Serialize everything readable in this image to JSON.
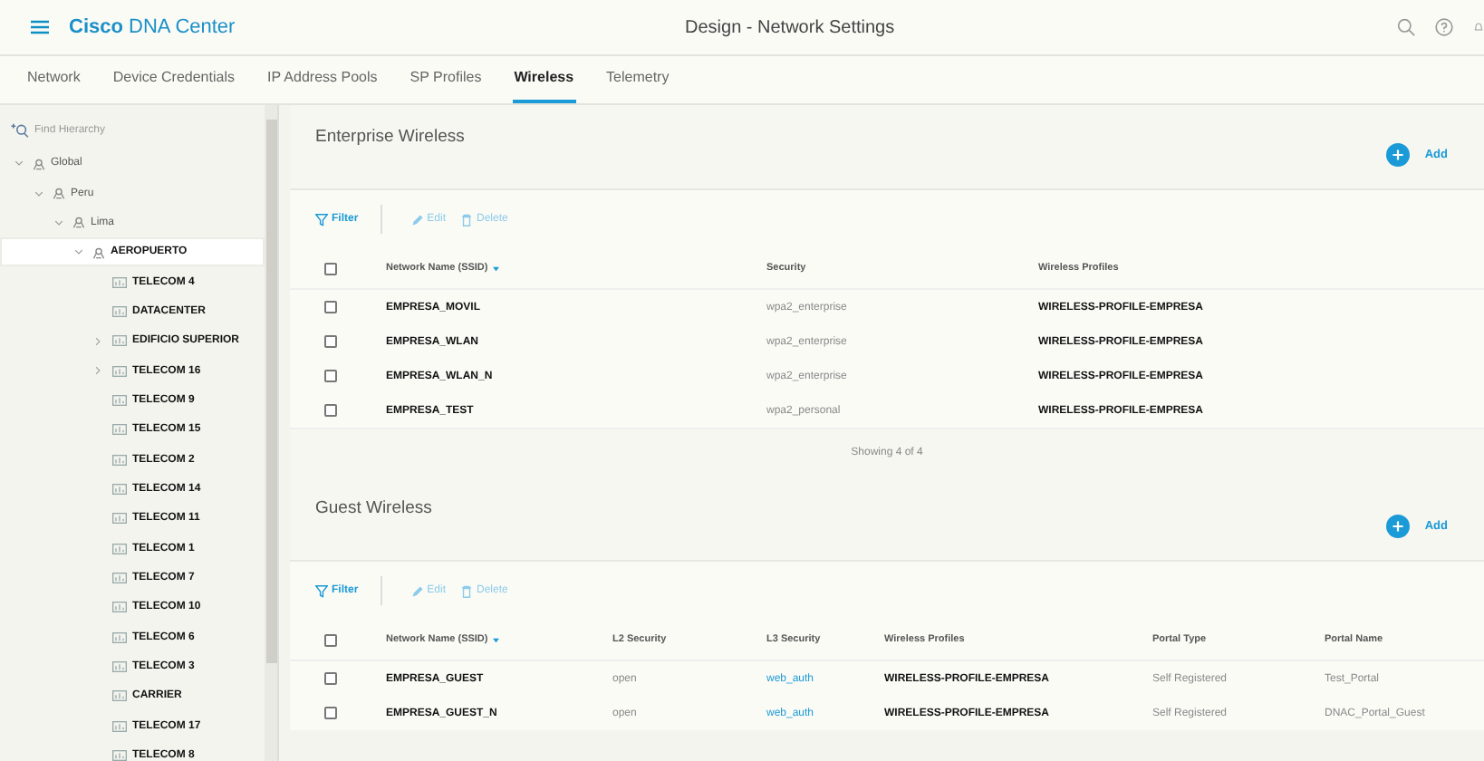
{
  "header": {
    "brand_bold": "Cisco",
    "brand_rest": "DNA Center",
    "title": "Design - Network Settings"
  },
  "tabs": [
    {
      "label": "Network",
      "selected": false
    },
    {
      "label": "Device Credentials",
      "selected": false
    },
    {
      "label": "IP Address Pools",
      "selected": false
    },
    {
      "label": "SP Profiles",
      "selected": false
    },
    {
      "label": "Wireless",
      "selected": true
    },
    {
      "label": "Telemetry",
      "selected": false
    }
  ],
  "sidebar": {
    "search": {
      "placeholder": "Find Hierarchy"
    },
    "tree": [
      {
        "label": "Global",
        "kind": "area",
        "expanded": true,
        "selected": false,
        "children": [
          {
            "label": "Peru",
            "kind": "area",
            "expanded": true,
            "selected": false,
            "children": [
              {
                "label": "Lima",
                "kind": "area",
                "expanded": true,
                "selected": false,
                "children": [
                  {
                    "label": "AEROPUERTO",
                    "kind": "area",
                    "expanded": true,
                    "selected": true,
                    "children": [
                      {
                        "label": "TELECOM 4",
                        "kind": "building",
                        "selected": false
                      },
                      {
                        "label": "DATACENTER",
                        "kind": "building",
                        "selected": false
                      },
                      {
                        "label": "EDIFICIO SUPERIOR",
                        "kind": "building",
                        "expanded": false,
                        "selected": false
                      },
                      {
                        "label": "TELECOM 16",
                        "kind": "building",
                        "expanded": false,
                        "selected": false
                      },
                      {
                        "label": "TELECOM 9",
                        "kind": "building",
                        "selected": false
                      },
                      {
                        "label": "TELECOM 15",
                        "kind": "building",
                        "selected": false
                      },
                      {
                        "label": "TELECOM 2",
                        "kind": "building",
                        "selected": false
                      },
                      {
                        "label": "TELECOM 14",
                        "kind": "building",
                        "selected": false
                      },
                      {
                        "label": "TELECOM 11",
                        "kind": "building",
                        "selected": false
                      },
                      {
                        "label": "TELECOM 1",
                        "kind": "building",
                        "selected": false
                      },
                      {
                        "label": "TELECOM 7",
                        "kind": "building",
                        "selected": false
                      },
                      {
                        "label": "TELECOM 10",
                        "kind": "building",
                        "selected": false
                      },
                      {
                        "label": "TELECOM 6",
                        "kind": "building",
                        "selected": false
                      },
                      {
                        "label": "TELECOM 3",
                        "kind": "building",
                        "selected": false
                      },
                      {
                        "label": "CARRIER",
                        "kind": "building",
                        "selected": false
                      },
                      {
                        "label": "TELECOM 17",
                        "kind": "building",
                        "selected": false
                      },
                      {
                        "label": "TELECOM 8",
                        "kind": "building",
                        "selected": false
                      }
                    ]
                  }
                ]
              }
            ]
          }
        ]
      }
    ]
  },
  "sections": [
    {
      "title": "Enterprise Wireless",
      "add": "Add",
      "filter": "Filter",
      "edit": "Edit",
      "delete": "Delete",
      "all_checked": false,
      "columns": [
        "Network Name (SSID)",
        "Security",
        "Wireless Profiles"
      ],
      "rows": [
        {
          "checked": false,
          "cells": [
            {
              "text": "EMPRESA_MOVIL",
              "kind": "bold"
            },
            {
              "text": "wpa2_enterprise",
              "kind": "muted"
            },
            {
              "text": "WIRELESS-PROFILE-EMPRESA",
              "kind": "bold"
            }
          ]
        },
        {
          "checked": false,
          "cells": [
            {
              "text": "EMPRESA_WLAN",
              "kind": "bold"
            },
            {
              "text": "wpa2_enterprise",
              "kind": "muted"
            },
            {
              "text": "WIRELESS-PROFILE-EMPRESA",
              "kind": "bold"
            }
          ]
        },
        {
          "checked": false,
          "cells": [
            {
              "text": "EMPRESA_WLAN_N",
              "kind": "bold"
            },
            {
              "text": "wpa2_enterprise",
              "kind": "muted"
            },
            {
              "text": "WIRELESS-PROFILE-EMPRESA",
              "kind": "bold"
            }
          ]
        },
        {
          "checked": false,
          "cells": [
            {
              "text": "EMPRESA_TEST",
              "kind": "bold"
            },
            {
              "text": "wpa2_personal",
              "kind": "muted"
            },
            {
              "text": "WIRELESS-PROFILE-EMPRESA",
              "kind": "bold"
            }
          ]
        }
      ],
      "footer": "Showing 4 of 4"
    },
    {
      "title": "Guest Wireless",
      "add": "Add",
      "filter": "Filter",
      "edit": "Edit",
      "delete": "Delete",
      "all_checked": false,
      "columns": [
        "Network Name (SSID)",
        "L2 Security",
        "L3 Security",
        "Wireless Profiles",
        "Portal Type",
        "Portal Name"
      ],
      "rows": [
        {
          "checked": false,
          "cells": [
            {
              "text": "EMPRESA_GUEST",
              "kind": "bold"
            },
            {
              "text": "open",
              "kind": "muted"
            },
            {
              "text": "web_auth",
              "kind": "link"
            },
            {
              "text": "WIRELESS-PROFILE-EMPRESA",
              "kind": "bold"
            },
            {
              "text": "Self Registered",
              "kind": "muted"
            },
            {
              "text": "Test_Portal",
              "kind": "muted"
            }
          ]
        },
        {
          "checked": false,
          "cells": [
            {
              "text": "EMPRESA_GUEST_N",
              "kind": "bold"
            },
            {
              "text": "open",
              "kind": "muted"
            },
            {
              "text": "web_auth",
              "kind": "link"
            },
            {
              "text": "WIRELESS-PROFILE-EMPRESA",
              "kind": "bold"
            },
            {
              "text": "Self Registered",
              "kind": "muted"
            },
            {
              "text": "DNAC_Portal_Guest",
              "kind": "muted"
            }
          ]
        }
      ]
    }
  ]
}
